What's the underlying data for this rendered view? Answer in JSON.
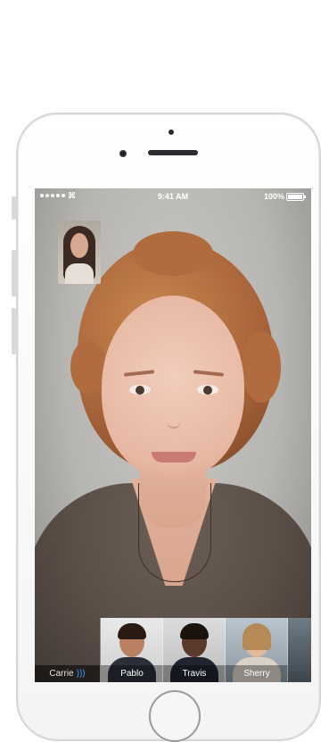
{
  "status_bar": {
    "time": "9:41 AM",
    "battery": "100%"
  },
  "call": {
    "caller_name": "Carrie"
  },
  "participants": [
    {
      "name": "Pablo"
    },
    {
      "name": "Travis"
    },
    {
      "name": "Sherry"
    }
  ],
  "colors": {
    "audio_indicator": "#3aa0ff",
    "phone_frame": "#d6d6d8"
  }
}
